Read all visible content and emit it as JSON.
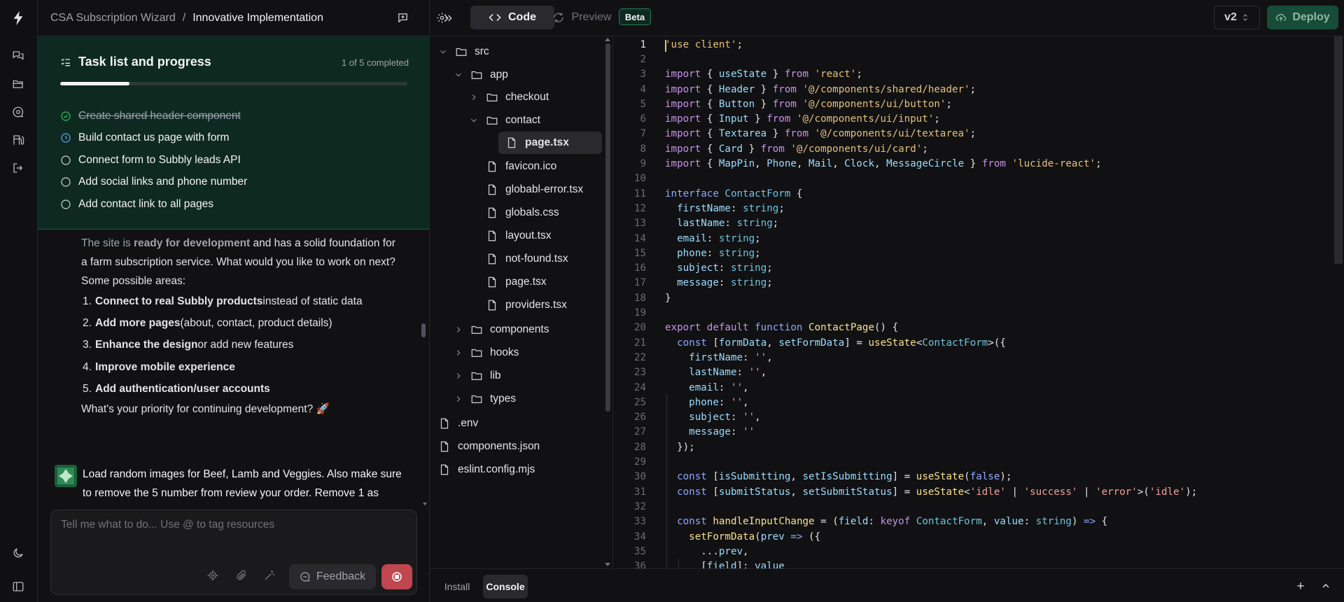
{
  "header": {
    "project": "CSA Subscription Wizard",
    "separator": "/",
    "page": "Innovative Implementation"
  },
  "tasks": {
    "title": "Task list and progress",
    "count": "1 of 5 completed",
    "progress": 0.2,
    "items": [
      {
        "label": "Create shared header component",
        "status": "done"
      },
      {
        "label": "Build contact us page with form",
        "status": "in-progress"
      },
      {
        "label": "Connect form to Subbly leads API",
        "status": "todo"
      },
      {
        "label": "Add social links and phone number",
        "status": "todo"
      },
      {
        "label": "Add contact link to all pages",
        "status": "todo"
      }
    ]
  },
  "assistant_msg": {
    "intro_a": "The site is ",
    "intro_b": "ready for development",
    "intro_c": " and has a solid foundation for a farm subscription service. What would you like to work on next? Some possible areas:",
    "items": [
      {
        "n": "1.",
        "bold": "Connect to real Subbly products",
        "rest": " instead of static data"
      },
      {
        "n": "2.",
        "bold": "Add more pages",
        "rest": " (about, contact, product details)"
      },
      {
        "n": "3.",
        "bold": "Enhance the design",
        "rest": " or add new features"
      },
      {
        "n": "4.",
        "bold": "Improve mobile experience",
        "rest": ""
      },
      {
        "n": "5.",
        "bold": "Add authentication/user accounts",
        "rest": ""
      }
    ],
    "outro": "What's your priority for continuing development? 🚀"
  },
  "user_msg": {
    "text": "Load random images for Beef, Lamb and Veggies. Also make sure to remove the 5 number from review your order. Remove 1 as"
  },
  "composer": {
    "placeholder": "Tell me what to do... Use @ to tag resources",
    "feedback_label": "Feedback"
  },
  "topbar": {
    "code_label": "Code",
    "preview_label": "Preview",
    "beta_label": "Beta",
    "version_label": "v2",
    "deploy_label": "Deploy"
  },
  "file_tree": [
    {
      "name": "src",
      "type": "folder",
      "open": true,
      "depth": 0
    },
    {
      "name": "app",
      "type": "folder",
      "open": true,
      "depth": 1
    },
    {
      "name": "checkout",
      "type": "folder",
      "open": false,
      "depth": 2
    },
    {
      "name": "contact",
      "type": "folder",
      "open": true,
      "depth": 2
    },
    {
      "name": "page.tsx",
      "type": "file",
      "depth": 3,
      "selected": true
    },
    {
      "name": "favicon.ico",
      "type": "file",
      "depth": 2
    },
    {
      "name": "globabl-error.tsx",
      "type": "file",
      "depth": 2
    },
    {
      "name": "globals.css",
      "type": "file",
      "depth": 2
    },
    {
      "name": "layout.tsx",
      "type": "file",
      "depth": 2
    },
    {
      "name": "not-found.tsx",
      "type": "file",
      "depth": 2
    },
    {
      "name": "page.tsx",
      "type": "file",
      "depth": 2
    },
    {
      "name": "providers.tsx",
      "type": "file",
      "depth": 2
    },
    {
      "name": "components",
      "type": "folder",
      "open": false,
      "depth": 1
    },
    {
      "name": "hooks",
      "type": "folder",
      "open": false,
      "depth": 1
    },
    {
      "name": "lib",
      "type": "folder",
      "open": false,
      "depth": 1
    },
    {
      "name": "types",
      "type": "folder",
      "open": false,
      "depth": 1
    },
    {
      "name": ".env",
      "type": "file",
      "depth": 0
    },
    {
      "name": "components.json",
      "type": "file",
      "depth": 0
    },
    {
      "name": "eslint.config.mjs",
      "type": "file",
      "depth": 0
    }
  ],
  "editor": {
    "current_line": 1,
    "lines": [
      [
        [
          "str",
          "'use client'"
        ],
        [
          "pl",
          ";"
        ]
      ],
      [],
      [
        [
          "kw",
          "import"
        ],
        [
          "pl",
          " { "
        ],
        [
          "id",
          "useState"
        ],
        [
          "pl",
          " } "
        ],
        [
          "kw",
          "from"
        ],
        [
          "pl",
          " "
        ],
        [
          "str",
          "'react'"
        ],
        [
          "pl",
          ";"
        ]
      ],
      [
        [
          "kw",
          "import"
        ],
        [
          "pl",
          " { "
        ],
        [
          "id",
          "Header"
        ],
        [
          "pl",
          " } "
        ],
        [
          "kw",
          "from"
        ],
        [
          "pl",
          " "
        ],
        [
          "str",
          "'@/components/shared/header'"
        ],
        [
          "pl",
          ";"
        ]
      ],
      [
        [
          "kw",
          "import"
        ],
        [
          "pl",
          " { "
        ],
        [
          "id",
          "Button"
        ],
        [
          "pl",
          " } "
        ],
        [
          "kw",
          "from"
        ],
        [
          "pl",
          " "
        ],
        [
          "str",
          "'@/components/ui/button'"
        ],
        [
          "pl",
          ";"
        ]
      ],
      [
        [
          "kw",
          "import"
        ],
        [
          "pl",
          " { "
        ],
        [
          "id",
          "Input"
        ],
        [
          "pl",
          " } "
        ],
        [
          "kw",
          "from"
        ],
        [
          "pl",
          " "
        ],
        [
          "str",
          "'@/components/ui/input'"
        ],
        [
          "pl",
          ";"
        ]
      ],
      [
        [
          "kw",
          "import"
        ],
        [
          "pl",
          " { "
        ],
        [
          "id",
          "Textarea"
        ],
        [
          "pl",
          " } "
        ],
        [
          "kw",
          "from"
        ],
        [
          "pl",
          " "
        ],
        [
          "str",
          "'@/components/ui/textarea'"
        ],
        [
          "pl",
          ";"
        ]
      ],
      [
        [
          "kw",
          "import"
        ],
        [
          "pl",
          " { "
        ],
        [
          "id",
          "Card"
        ],
        [
          "pl",
          " } "
        ],
        [
          "kw",
          "from"
        ],
        [
          "pl",
          " "
        ],
        [
          "str",
          "'@/components/ui/card'"
        ],
        [
          "pl",
          ";"
        ]
      ],
      [
        [
          "kw",
          "import"
        ],
        [
          "pl",
          " { "
        ],
        [
          "id",
          "MapPin"
        ],
        [
          "pl",
          ", "
        ],
        [
          "id",
          "Phone"
        ],
        [
          "pl",
          ", "
        ],
        [
          "id",
          "Mail"
        ],
        [
          "pl",
          ", "
        ],
        [
          "id",
          "Clock"
        ],
        [
          "pl",
          ", "
        ],
        [
          "id",
          "MessageCircle"
        ],
        [
          "pl",
          " } "
        ],
        [
          "kw",
          "from"
        ],
        [
          "pl",
          " "
        ],
        [
          "str",
          "'lucide-react'"
        ],
        [
          "pl",
          ";"
        ]
      ],
      [],
      [
        [
          "kw2",
          "interface"
        ],
        [
          "pl",
          " "
        ],
        [
          "ty",
          "ContactForm"
        ],
        [
          "pl",
          " {"
        ]
      ],
      [
        [
          "pl",
          "  "
        ],
        [
          "id",
          "firstName"
        ],
        [
          "pl",
          ": "
        ],
        [
          "ty",
          "string"
        ],
        [
          "pl",
          ";"
        ]
      ],
      [
        [
          "pl",
          "  "
        ],
        [
          "id",
          "lastName"
        ],
        [
          "pl",
          ": "
        ],
        [
          "ty",
          "string"
        ],
        [
          "pl",
          ";"
        ]
      ],
      [
        [
          "pl",
          "  "
        ],
        [
          "id",
          "email"
        ],
        [
          "pl",
          ": "
        ],
        [
          "ty",
          "string"
        ],
        [
          "pl",
          ";"
        ]
      ],
      [
        [
          "pl",
          "  "
        ],
        [
          "id",
          "phone"
        ],
        [
          "pl",
          ": "
        ],
        [
          "ty",
          "string"
        ],
        [
          "pl",
          ";"
        ]
      ],
      [
        [
          "pl",
          "  "
        ],
        [
          "id",
          "subject"
        ],
        [
          "pl",
          ": "
        ],
        [
          "ty",
          "string"
        ],
        [
          "pl",
          ";"
        ]
      ],
      [
        [
          "pl",
          "  "
        ],
        [
          "id",
          "message"
        ],
        [
          "pl",
          ": "
        ],
        [
          "ty",
          "string"
        ],
        [
          "pl",
          ";"
        ]
      ],
      [
        [
          "pl",
          "}"
        ]
      ],
      [],
      [
        [
          "kw",
          "export"
        ],
        [
          "pl",
          " "
        ],
        [
          "kw",
          "default"
        ],
        [
          "pl",
          " "
        ],
        [
          "kw2",
          "function"
        ],
        [
          "pl",
          " "
        ],
        [
          "fn",
          "ContactPage"
        ],
        [
          "pl",
          "() {"
        ]
      ],
      [
        [
          "pl",
          "  "
        ],
        [
          "kw2",
          "const"
        ],
        [
          "pl",
          " ["
        ],
        [
          "id",
          "formData"
        ],
        [
          "pl",
          ", "
        ],
        [
          "id",
          "setFormData"
        ],
        [
          "pl",
          "] = "
        ],
        [
          "fn",
          "useState"
        ],
        [
          "pl",
          "<"
        ],
        [
          "ty",
          "ContactForm"
        ],
        [
          "pl",
          ">({"
        ]
      ],
      [
        [
          "pl",
          "    "
        ],
        [
          "id",
          "firstName"
        ],
        [
          "pl",
          ": "
        ],
        [
          "str2",
          "''"
        ],
        [
          "pl",
          ","
        ]
      ],
      [
        [
          "pl",
          "    "
        ],
        [
          "id",
          "lastName"
        ],
        [
          "pl",
          ": "
        ],
        [
          "str2",
          "''"
        ],
        [
          "pl",
          ","
        ]
      ],
      [
        [
          "pl",
          "    "
        ],
        [
          "id",
          "email"
        ],
        [
          "pl",
          ": "
        ],
        [
          "str2",
          "''"
        ],
        [
          "pl",
          ","
        ]
      ],
      [
        [
          "pl",
          "    "
        ],
        [
          "id",
          "phone"
        ],
        [
          "pl",
          ": "
        ],
        [
          "str2",
          "''"
        ],
        [
          "pl",
          ","
        ]
      ],
      [
        [
          "pl",
          "    "
        ],
        [
          "id",
          "subject"
        ],
        [
          "pl",
          ": "
        ],
        [
          "str2",
          "''"
        ],
        [
          "pl",
          ","
        ]
      ],
      [
        [
          "pl",
          "    "
        ],
        [
          "id",
          "message"
        ],
        [
          "pl",
          ": "
        ],
        [
          "str2",
          "''"
        ]
      ],
      [
        [
          "pl",
          "  });"
        ]
      ],
      [],
      [
        [
          "pl",
          "  "
        ],
        [
          "kw2",
          "const"
        ],
        [
          "pl",
          " ["
        ],
        [
          "id",
          "isSubmitting"
        ],
        [
          "pl",
          ", "
        ],
        [
          "id",
          "setIsSubmitting"
        ],
        [
          "pl",
          "] = "
        ],
        [
          "fn",
          "useState"
        ],
        [
          "pl",
          "("
        ],
        [
          "kw2",
          "false"
        ],
        [
          "pl",
          ");"
        ]
      ],
      [
        [
          "pl",
          "  "
        ],
        [
          "kw2",
          "const"
        ],
        [
          "pl",
          " ["
        ],
        [
          "id",
          "submitStatus"
        ],
        [
          "pl",
          ", "
        ],
        [
          "id",
          "setSubmitStatus"
        ],
        [
          "pl",
          "] = "
        ],
        [
          "fn",
          "useState"
        ],
        [
          "pl",
          "<"
        ],
        [
          "str2",
          "'idle'"
        ],
        [
          "pl",
          " | "
        ],
        [
          "str2",
          "'success'"
        ],
        [
          "pl",
          " | "
        ],
        [
          "str2",
          "'error'"
        ],
        [
          "pl",
          ">("
        ],
        [
          "str2",
          "'idle'"
        ],
        [
          "pl",
          ");"
        ]
      ],
      [],
      [
        [
          "pl",
          "  "
        ],
        [
          "kw2",
          "const"
        ],
        [
          "pl",
          " "
        ],
        [
          "fn",
          "handleInputChange"
        ],
        [
          "pl",
          " = ("
        ],
        [
          "id",
          "field"
        ],
        [
          "pl",
          ": "
        ],
        [
          "kw",
          "keyof"
        ],
        [
          "pl",
          " "
        ],
        [
          "ty",
          "ContactForm"
        ],
        [
          "pl",
          ", "
        ],
        [
          "id",
          "value"
        ],
        [
          "pl",
          ": "
        ],
        [
          "ty",
          "string"
        ],
        [
          "pl",
          ") "
        ],
        [
          "kw2",
          "=>"
        ],
        [
          "pl",
          " {"
        ]
      ],
      [
        [
          "pl",
          "    "
        ],
        [
          "fn",
          "setFormData"
        ],
        [
          "pl",
          "("
        ],
        [
          "id",
          "prev"
        ],
        [
          "pl",
          " "
        ],
        [
          "kw2",
          "=>"
        ],
        [
          "pl",
          " ({"
        ]
      ],
      [
        [
          "pl",
          "      ..."
        ],
        [
          "id",
          "prev"
        ],
        [
          "pl",
          ","
        ]
      ],
      [
        [
          "pl",
          "      ["
        ],
        [
          "id",
          "field"
        ],
        [
          "pl",
          "]: "
        ],
        [
          "id",
          "value"
        ]
      ]
    ]
  },
  "bottom": {
    "install_label": "Install",
    "console_label": "Console"
  }
}
